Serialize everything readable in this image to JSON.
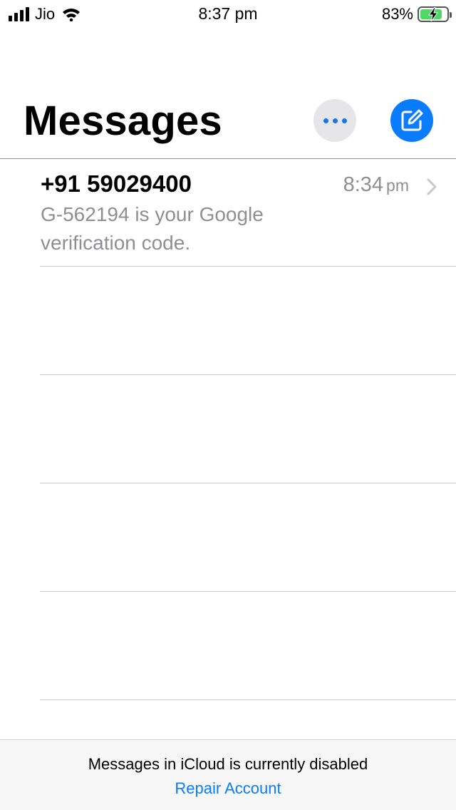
{
  "status_bar": {
    "carrier": "Jio",
    "time": "8:37 pm",
    "battery_percent": "83%",
    "battery_level": 0.83,
    "charging": true,
    "signal_bars": 4,
    "icons": [
      "signal-bars-icon",
      "wifi-icon",
      "battery-icon",
      "charging-bolt-icon"
    ]
  },
  "header": {
    "title": "Messages",
    "more_icon": "ellipsis-icon",
    "compose_icon": "compose-icon"
  },
  "conversations": [
    {
      "name": "+91 59029400",
      "time": "8:34",
      "time_suffix": "pm",
      "preview": "G-562194 is your Google verification code."
    }
  ],
  "footer": {
    "message": "Messages in iCloud is currently disabled",
    "link": "Repair Account"
  },
  "colors": {
    "accent": "#0a7cff",
    "secondary_text": "#8e8e93",
    "more_button_bg": "#e5e5ea",
    "battery_green": "#4cd964"
  }
}
